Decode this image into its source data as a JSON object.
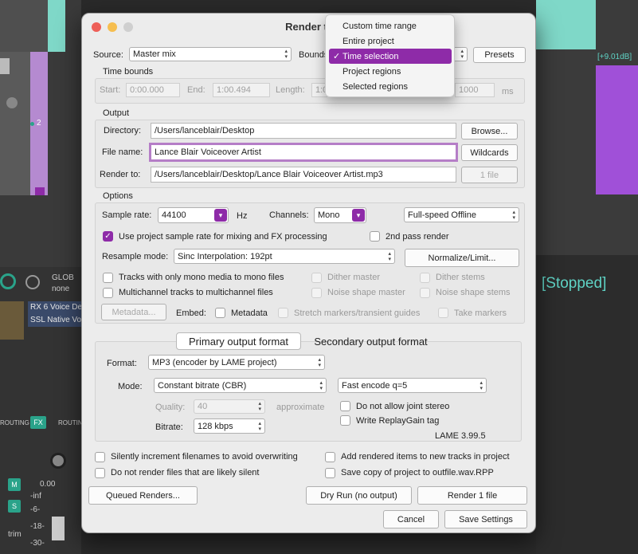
{
  "daw": {
    "db_label": "[+9.01dB]",
    "track_num": "2",
    "stopped": "[Stopped]",
    "route_label_1": "ROUTING",
    "route_label_2": "ROUTING",
    "fx_label": "FX",
    "fx_chain_1": "RX 6 Voice De",
    "fx_chain_2": "SSL Native Vo",
    "gain_val": "0.00",
    "db_ticks": [
      "-inf",
      "-6-",
      "-18-",
      "-30-"
    ],
    "mute_label": "M",
    "solo_label": "S",
    "trim_label": "trim",
    "global_label": "GLOB",
    "none_label": "none"
  },
  "dialog": {
    "title": "Render to",
    "source_label": "Source:",
    "source_value": "Master mix",
    "bounds_label": "Bounds",
    "presets_button": "Presets",
    "time_bounds": {
      "heading": "Time bounds",
      "start_label": "Start:",
      "start_value": "0:00.000",
      "end_label": "End:",
      "end_value": "1:00.494",
      "length_label": "Length:",
      "length_value": "1:0",
      "tail_value": "1000",
      "ms_label": "ms"
    },
    "output": {
      "heading": "Output",
      "directory_label": "Directory:",
      "directory_value": "/Users/lanceblair/Desktop",
      "browse_button": "Browse...",
      "filename_label": "File name:",
      "filename_value": "Lance Blair Voiceover Artist",
      "wildcards_button": "Wildcards",
      "renderto_label": "Render to:",
      "renderto_value": "/Users/lanceblair/Desktop/Lance Blair Voiceover Artist.mp3",
      "files_button": "1 file"
    },
    "options": {
      "heading": "Options",
      "sample_rate_label": "Sample rate:",
      "sample_rate_value": "44100",
      "hz_label": "Hz",
      "channels_label": "Channels:",
      "channels_value": "Mono",
      "speed_value": "Full-speed Offline",
      "use_project_sr": "Use project sample rate for mixing and FX processing",
      "second_pass": "2nd pass render",
      "resample_label": "Resample mode:",
      "resample_value": "Sinc Interpolation: 192pt",
      "normalize_button": "Normalize/Limit...",
      "mono_tracks": "Tracks with only mono media to mono files",
      "dither_master": "Dither master",
      "dither_stems": "Dither stems",
      "multichannel": "Multichannel tracks to multichannel files",
      "noise_master": "Noise shape master",
      "noise_stems": "Noise shape stems",
      "metadata_button": "Metadata...",
      "embed_label": "Embed:",
      "metadata_check": "Metadata",
      "stretch_markers": "Stretch markers/transient guides",
      "take_markers": "Take markers"
    },
    "format": {
      "tab_primary": "Primary output format",
      "tab_secondary": "Secondary output format",
      "format_label": "Format:",
      "format_value": "MP3 (encoder by LAME project)",
      "mode_label": "Mode:",
      "mode_value": "Constant bitrate  (CBR)",
      "encode_value": "Fast encode q=5",
      "quality_label": "Quality:",
      "quality_value": "40",
      "approximate_label": "approximate",
      "joint_stereo": "Do not allow joint stereo",
      "bitrate_label": "Bitrate:",
      "bitrate_value": "128 kbps",
      "replaygain": "Write ReplayGain tag",
      "lame_version": "LAME 3.99.5"
    },
    "footer": {
      "silently_increment": "Silently increment filenames to avoid overwriting",
      "add_rendered": "Add rendered items to new tracks in project",
      "no_silent": "Do not render files that are likely silent",
      "save_copy": "Save copy of project to outfile.wav.RPP",
      "queued_button": "Queued Renders...",
      "dryrun_button": "Dry Run (no output)",
      "render_button": "Render 1 file",
      "cancel_button": "Cancel",
      "save_settings_button": "Save Settings"
    }
  },
  "bounds_menu": {
    "items": [
      "Custom time range",
      "Entire project",
      "Time selection",
      "Project regions",
      "Selected regions"
    ],
    "selected": "Time selection"
  },
  "colors": {
    "accent": "#8e2ba8",
    "daw_teal": "#2aa38a",
    "stopped_text": "#5fd3c5"
  }
}
